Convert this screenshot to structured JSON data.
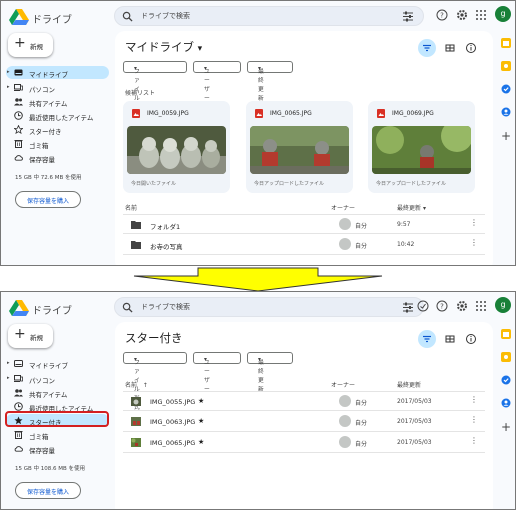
{
  "app": {
    "name": "ドライブ"
  },
  "search": {
    "placeholder": "ドライブで検索"
  },
  "colors": {
    "active_nav": "#c2e7ff",
    "accent_blue": "#0b57d0",
    "avatar": "#188038",
    "highlight": "#d32020",
    "arrow": "#ffff00"
  },
  "top": {
    "new_label": "新規",
    "avatar_letter": "g",
    "nav": [
      {
        "label": "マイドライブ",
        "icon": "my-drive-icon",
        "active": true
      },
      {
        "label": "パソコン",
        "icon": "computer-icon",
        "active": false
      },
      {
        "label": "共有アイテム",
        "icon": "shared-icon",
        "active": false
      },
      {
        "label": "最近使用したアイテム",
        "icon": "recent-clock-icon",
        "active": false
      },
      {
        "label": "スター付き",
        "icon": "star-outline-icon",
        "active": false
      },
      {
        "label": "ゴミ箱",
        "icon": "trash-icon",
        "active": false
      },
      {
        "label": "保存容量",
        "icon": "cloud-icon",
        "active": false
      }
    ],
    "storage_text": "15 GB 中 72.6 MB を使用",
    "buy_label": "保存容量を購入",
    "title": "マイドライブ",
    "title_caret": "▾",
    "filters": [
      {
        "label": "ファイル形式",
        "caret": "▾"
      },
      {
        "label": "ユーザー",
        "caret": "▾"
      },
      {
        "label": "最終更新",
        "caret": "▾"
      }
    ],
    "suggest_label": "候補リスト",
    "cards": [
      {
        "title": "IMG_0059.JPG",
        "subtitle": "今日開いたファイル"
      },
      {
        "title": "IMG_0065.JPG",
        "subtitle": "今日アップロードしたファイル"
      },
      {
        "title": "IMG_0069.JPG",
        "subtitle": "今日アップロードしたファイル"
      }
    ],
    "columns": {
      "name": "名前",
      "owner": "オーナー",
      "modified": "最終更新"
    },
    "sort_arrow": "▾",
    "rows": [
      {
        "name": "フォルダ1",
        "owner": "自分",
        "modified": "9:57"
      },
      {
        "name": "お寺の写真",
        "owner": "自分",
        "modified": "10:42"
      }
    ]
  },
  "bottom": {
    "new_label": "新規",
    "avatar_letter": "g",
    "nav": [
      {
        "label": "マイドライブ",
        "icon": "my-drive-icon",
        "active": false
      },
      {
        "label": "パソコン",
        "icon": "computer-icon",
        "active": false
      },
      {
        "label": "共有アイテム",
        "icon": "shared-icon",
        "active": false
      },
      {
        "label": "最近使用したアイテム",
        "icon": "recent-clock-icon",
        "active": false
      },
      {
        "label": "スター付き",
        "icon": "star-filled-icon",
        "active": true
      },
      {
        "label": "ゴミ箱",
        "icon": "trash-icon",
        "active": false
      },
      {
        "label": "保存容量",
        "icon": "cloud-icon",
        "active": false
      }
    ],
    "storage_text": "15 GB 中 108.6 MB を使用",
    "buy_label": "保存容量を購入",
    "title": "スター付き",
    "filters": [
      {
        "label": "ファイル形式",
        "caret": "▾"
      },
      {
        "label": "ユーザー",
        "caret": "▾"
      },
      {
        "label": "最終更新",
        "caret": "▾"
      }
    ],
    "columns": {
      "name": "名前",
      "owner": "オーナー",
      "modified": "最終更新"
    },
    "sort_arrow": "↑",
    "rows": [
      {
        "name": "IMG_0055.JPG",
        "owner": "自分",
        "modified": "2017/05/03",
        "star": "★"
      },
      {
        "name": "IMG_0063.JPG",
        "owner": "自分",
        "modified": "2017/05/03",
        "star": "★"
      },
      {
        "name": "IMG_0065.JPG",
        "owner": "自分",
        "modified": "2017/05/03",
        "star": "★"
      }
    ]
  }
}
